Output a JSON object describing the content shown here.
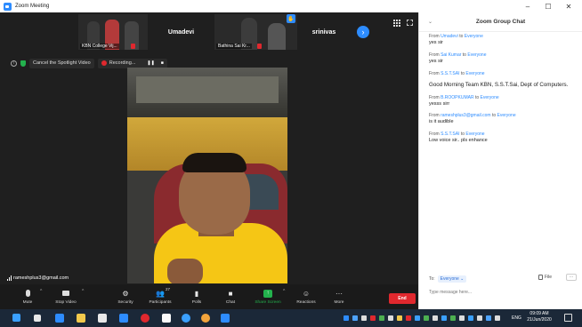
{
  "window": {
    "title": "Zoom Meeting",
    "minimize": "–",
    "maximize": "☐",
    "close": "✕"
  },
  "thumbnails": [
    {
      "label": "KBN College Vij..."
    },
    {
      "name": "Umadevi"
    },
    {
      "label": "Bathina Sai Kr..."
    },
    {
      "name": "srinivas"
    }
  ],
  "spotlight": {
    "cancel_label": "Cancel the Spotlight Video",
    "recording_label": "Recording...",
    "pause": "❚❚",
    "stop": "■"
  },
  "speaker": {
    "name": "rameshplus3@gmail.com"
  },
  "toolbar": {
    "mute": "Mute",
    "stop_video": "Stop Video",
    "security": "Security",
    "participants": "Participants",
    "participants_count": "27",
    "polls": "Polls",
    "chat": "Chat",
    "share_screen": "Share Screen",
    "reactions": "Reactions",
    "more": "More",
    "end": "End"
  },
  "chat": {
    "title": "Zoom Group Chat",
    "messages": [
      {
        "from": "Umadevi",
        "to": "Everyone",
        "text": "yes sir"
      },
      {
        "from": "Sai Kumar",
        "to": "Everyone",
        "text": "yes sir"
      },
      {
        "from": "S.S.T.SAI",
        "to": "Everyone",
        "text": "Good Morning Team KBN, S.S.T.Sai, Dept of Computers."
      },
      {
        "from": "B.ROOPKUMAR",
        "to": "Everyone",
        "text": "yesss sirr"
      },
      {
        "from": "rameshplus3@gmail.com",
        "to": "Everyone",
        "text": "is it audible"
      },
      {
        "from": "S.S.T.SAI",
        "to": "Everyone",
        "text": "Low voice sir.. pls enhance"
      }
    ],
    "from_word": "From",
    "to_word": "to",
    "to_label": "To:",
    "to_value": "Everyone",
    "file_label": "File",
    "more": "···",
    "input_placeholder": "Type message here..."
  },
  "taskbar": {
    "lang": "ENG",
    "time": "09:09 AM",
    "date": "21/Jun/2020"
  },
  "colors": {
    "zoom_blue": "#2d8cff",
    "end_red": "#e0282e",
    "share_green": "#23b14d"
  }
}
